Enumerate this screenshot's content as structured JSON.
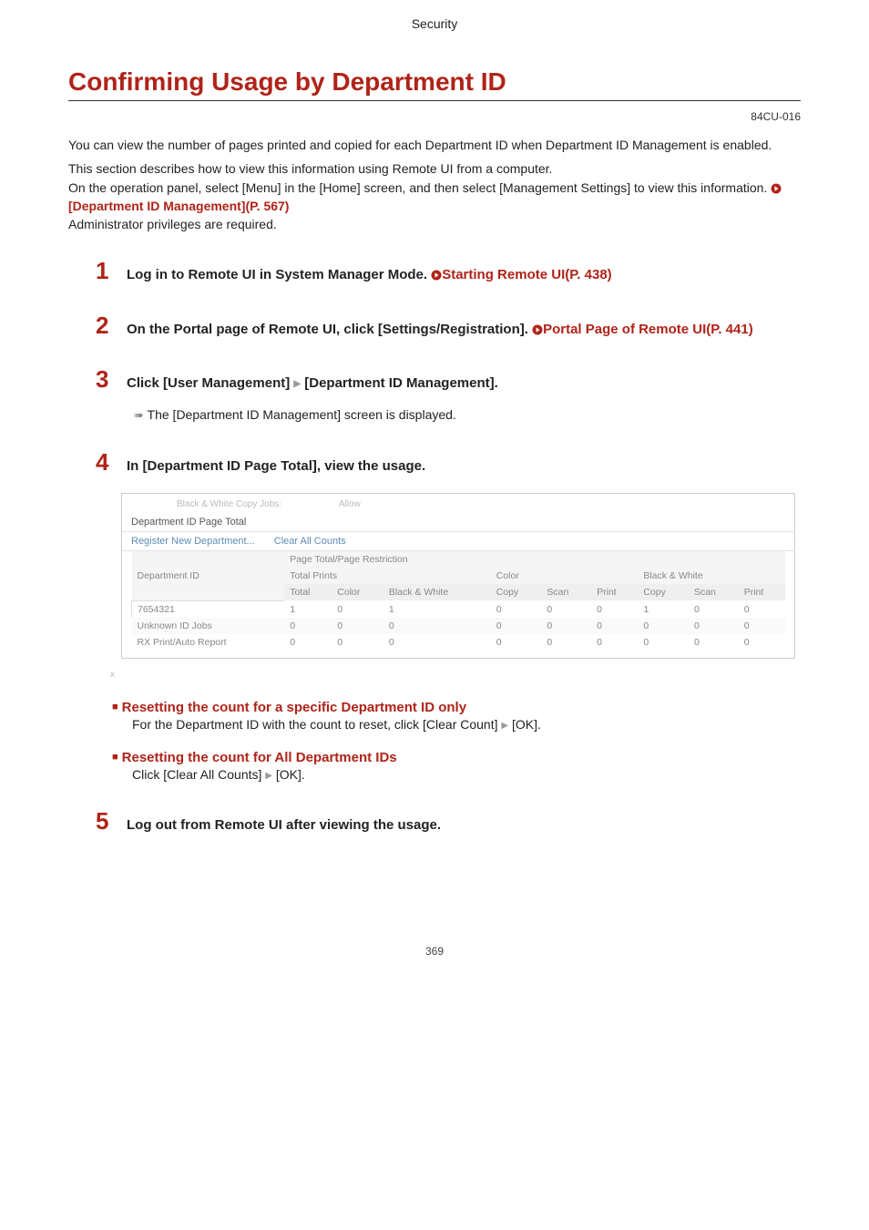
{
  "header": {
    "section": "Security"
  },
  "title": "Confirming Usage by Department ID",
  "doc_code": "84CU-016",
  "intro": {
    "p1": "You can view the number of pages printed and copied for each Department ID when Department ID Management is enabled.",
    "p2a": "This section describes how to view this information using Remote UI from a computer.",
    "p2b": "On the operation panel, select [Menu] in the [Home] screen, and then select [Management Settings] to view this information. ",
    "p2_link": "[Department ID Management](P. 567)",
    "p3": "Administrator privileges are required."
  },
  "steps": {
    "s1": {
      "num": "1",
      "text_a": "Log in to Remote UI in System Manager Mode. ",
      "link": "Starting Remote UI(P. 438)"
    },
    "s2": {
      "num": "2",
      "text_a": "On the Portal page of Remote UI, click [Settings/Registration]. ",
      "link": "Portal Page of Remote UI(P. 441)"
    },
    "s3": {
      "num": "3",
      "text_a": "Click [User Management] ",
      "text_b": " [Department ID Management].",
      "body": "The [Department ID Management] screen is displayed."
    },
    "s4": {
      "num": "4",
      "text": "In [Department ID Page Total], view the usage."
    },
    "s5": {
      "num": "5",
      "text": "Log out from Remote UI after viewing the usage."
    }
  },
  "screenshot": {
    "faint_label": "Black & White Copy Jobs:",
    "faint_value": "Allow",
    "section_title": "Department ID Page Total",
    "action_register": "Register New Department...",
    "action_clear": "Clear All Counts",
    "headers": {
      "group_page": "Page Total/Page Restriction",
      "dept_id": "Department ID",
      "total_prints": "Total Prints",
      "color": "Color",
      "bw": "Black & White",
      "total": "Total",
      "colorcol": "Color",
      "bwcol": "Black & White",
      "copy": "Copy",
      "scan": "Scan",
      "print": "Print"
    },
    "rows": [
      {
        "id": "7654321",
        "tp_total": "1",
        "tp_color": "0",
        "tp_bw": "1",
        "c_copy": "0",
        "c_scan": "0",
        "c_print": "0",
        "b_copy": "1",
        "b_scan": "0",
        "b_print": "0"
      },
      {
        "id": "Unknown ID Jobs",
        "tp_total": "0",
        "tp_color": "0",
        "tp_bw": "0",
        "c_copy": "0",
        "c_scan": "0",
        "c_print": "0",
        "b_copy": "0",
        "b_scan": "0",
        "b_print": "0"
      },
      {
        "id": "RX Print/Auto Report",
        "tp_total": "0",
        "tp_color": "0",
        "tp_bw": "0",
        "c_copy": "0",
        "c_scan": "0",
        "c_print": "0",
        "b_copy": "0",
        "b_scan": "0",
        "b_print": "0"
      }
    ],
    "footer_mark": "x"
  },
  "sub1": {
    "title": "Resetting the count for a specific Department ID only",
    "body_a": "For the Department ID with the count to reset, click [Clear Count] ",
    "body_b": " [OK]."
  },
  "sub2": {
    "title": "Resetting the count for All Department IDs",
    "body_a": "Click [Clear All Counts] ",
    "body_b": " [OK]."
  },
  "page_number": "369"
}
